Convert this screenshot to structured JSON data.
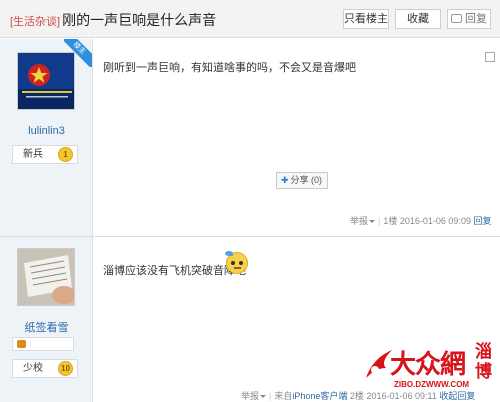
{
  "header": {
    "category": "[生活杂谈]",
    "title": "刚的一声巨响是什么声音",
    "only_op_label": "只看楼主",
    "favorite_label": "收藏",
    "reply_label": "回复"
  },
  "posts": [
    {
      "username": "lulinlin3",
      "rank": "新兵",
      "level": "1",
      "op_badge": "楼主",
      "avatar_caption": "中国人的家园 有一种精神叫…",
      "content": "刚听到一声巨响，有知道啥事的吗，不会又是音爆吧",
      "share_label": "分享 (0)",
      "report_label": "举报",
      "floor": "1楼",
      "time": "2016-01-06 09:09",
      "reply_label": "回复"
    },
    {
      "username": "纸签看雪",
      "rank": "少校",
      "level": "10",
      "content": "淄博应该没有飞机突破音障吧",
      "report_label": "举报",
      "source_prefix": "来自",
      "source_link": "iPhone客户端",
      "floor": "2楼",
      "time": "2016-01-06 09:11",
      "reply_label": "收起回复"
    }
  ],
  "watermark": {
    "main": "大众網",
    "side": "淄博",
    "url": "ZIBO.DZWWW.COM"
  },
  "colors": {
    "link": "#2e6aa8",
    "category": "#d04a4a",
    "watermark": "#d8131b",
    "sidebar_bg": "#eef3f8"
  }
}
